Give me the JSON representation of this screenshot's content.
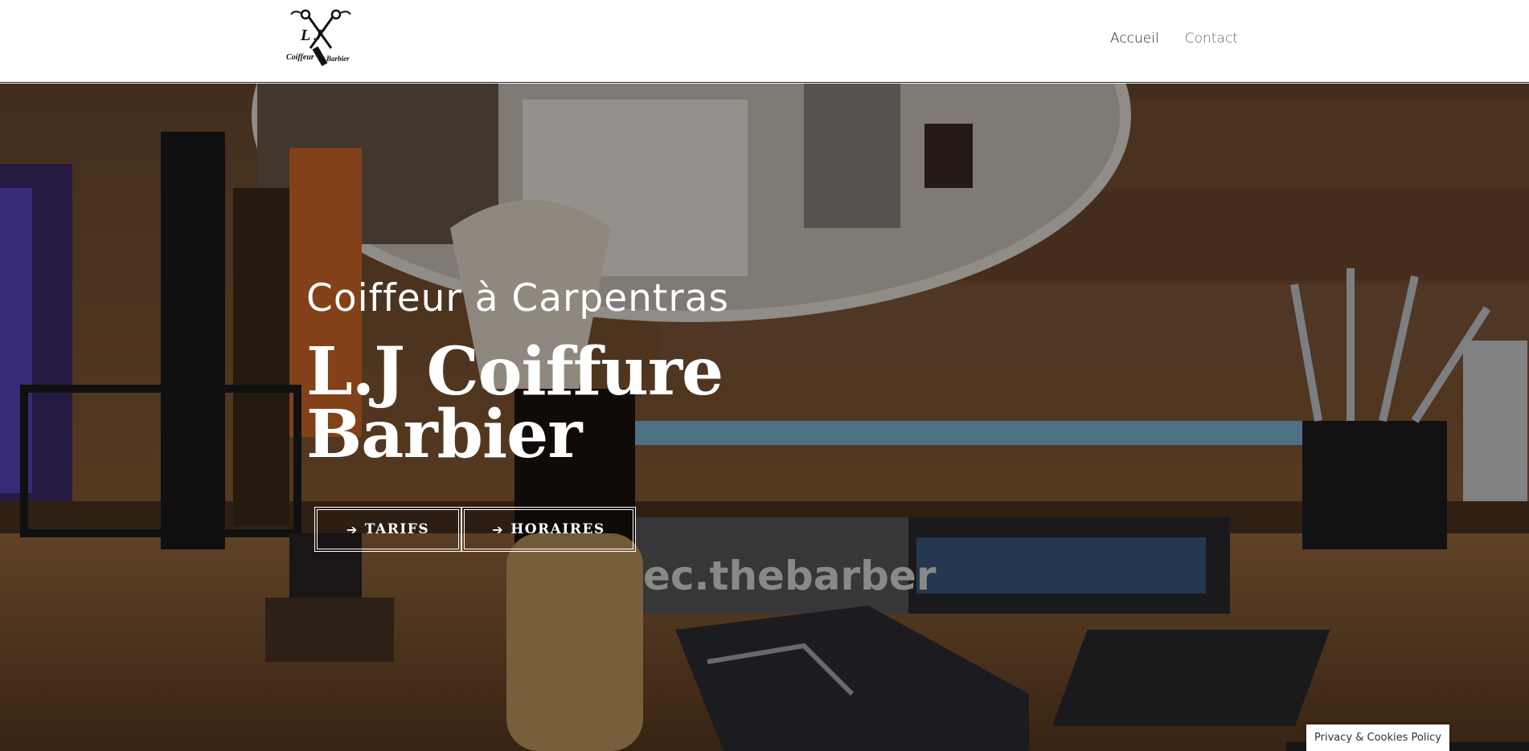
{
  "header": {
    "logo": {
      "initials": "L J",
      "left_word": "Coiffeur",
      "right_word": "Barbier"
    },
    "nav": [
      {
        "label": "Accueil"
      },
      {
        "label": "Contact"
      }
    ]
  },
  "hero": {
    "subtitle": "Coiffeur à Carpentras",
    "title_line1": "L.J Coiffure",
    "title_line2": "Barbier",
    "buttons": [
      {
        "label": "TARIFS",
        "icon": "arrow-right-icon"
      },
      {
        "label": "HORAIRES",
        "icon": "arrow-right-icon"
      }
    ],
    "background_text": "ec.thebarber"
  },
  "privacy_banner": {
    "label": "Privacy & Cookies Policy"
  },
  "colors": {
    "header_bg": "#ffffff",
    "hero_text": "#ffffff",
    "nav_text": "#333333"
  }
}
